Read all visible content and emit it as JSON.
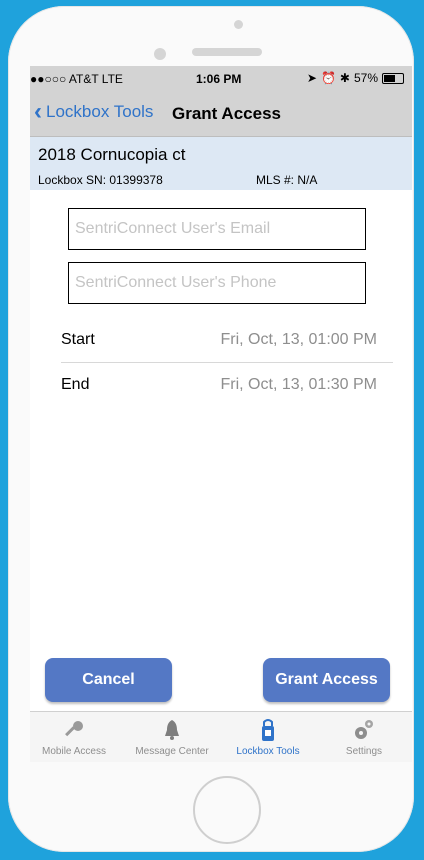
{
  "status_bar": {
    "carrier": "●●○○○ AT&T  LTE",
    "time": "1:06 PM",
    "battery": "57%"
  },
  "nav": {
    "back_label": "Lockbox Tools",
    "title": "Grant Access"
  },
  "property": {
    "address": "2018 Cornucopia ct",
    "lockbox_sn": "Lockbox SN: 01399378",
    "mls": "MLS #: N/A"
  },
  "form": {
    "email_placeholder": "SentriConnect User's Email",
    "phone_placeholder": "SentriConnect User's Phone",
    "start_label": "Start",
    "start_value": "Fri, Oct, 13, 01:00 PM",
    "end_label": "End",
    "end_value": "Fri, Oct, 13, 01:30 PM"
  },
  "buttons": {
    "cancel": "Cancel",
    "grant": "Grant Access"
  },
  "tabs": [
    {
      "label": "Mobile Access",
      "icon": "key-icon"
    },
    {
      "label": "Message Center",
      "icon": "bell-icon"
    },
    {
      "label": "Lockbox Tools",
      "icon": "lockbox-icon",
      "active": true
    },
    {
      "label": "Settings",
      "icon": "gears-icon"
    }
  ],
  "colors": {
    "accent": "#2f73c9",
    "button": "#5478c5",
    "panel": "#dde8f4",
    "bezel_bg": "#1fa2dc"
  }
}
